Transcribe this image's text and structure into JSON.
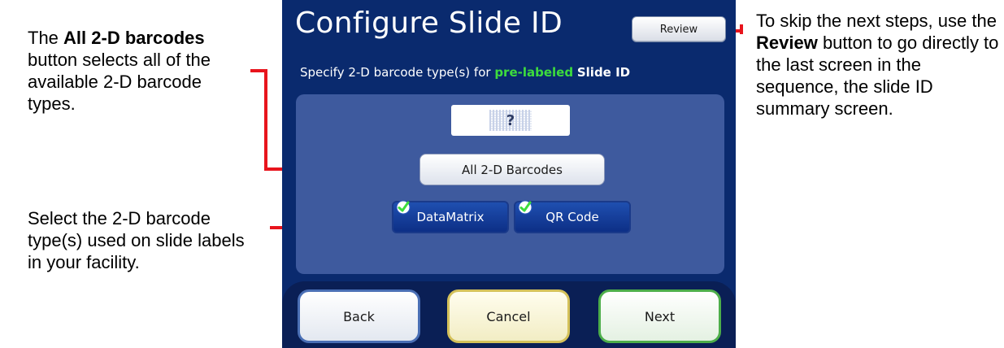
{
  "annotations": {
    "all_barcodes": {
      "bold": "All 2-D barcodes",
      "before": "The ",
      "after": " button selects all of the available 2-D barcode types."
    },
    "select_types": "Select the 2-D barcode type(s) used on slide labels in your facility.",
    "review": {
      "before": "To skip the next steps, use the ",
      "bold": "Review",
      "after": " button to go directly to the last screen in the sequence, the slide ID summary screen."
    }
  },
  "screen": {
    "title": "Configure Slide ID",
    "review_label": "Review",
    "instruction": {
      "prefix": "Specify 2-D barcode type(s) for ",
      "highlight": "pre-labeled",
      "suffix": "Slide ID"
    },
    "barcode_preview_symbol": "?",
    "all_barcodes_label": "All 2-D Barcodes",
    "barcode_types": [
      {
        "label": "DataMatrix",
        "checked": true
      },
      {
        "label": "QR Code",
        "checked": true
      }
    ],
    "nav": {
      "back": "Back",
      "cancel": "Cancel",
      "next": "Next"
    }
  },
  "colors": {
    "screen_bg": "#0a2a6e",
    "panel_bg": "#3e5a9e",
    "highlight": "#3ddc3d",
    "callout_line": "#e8141c",
    "check": "#3ddc3d"
  }
}
